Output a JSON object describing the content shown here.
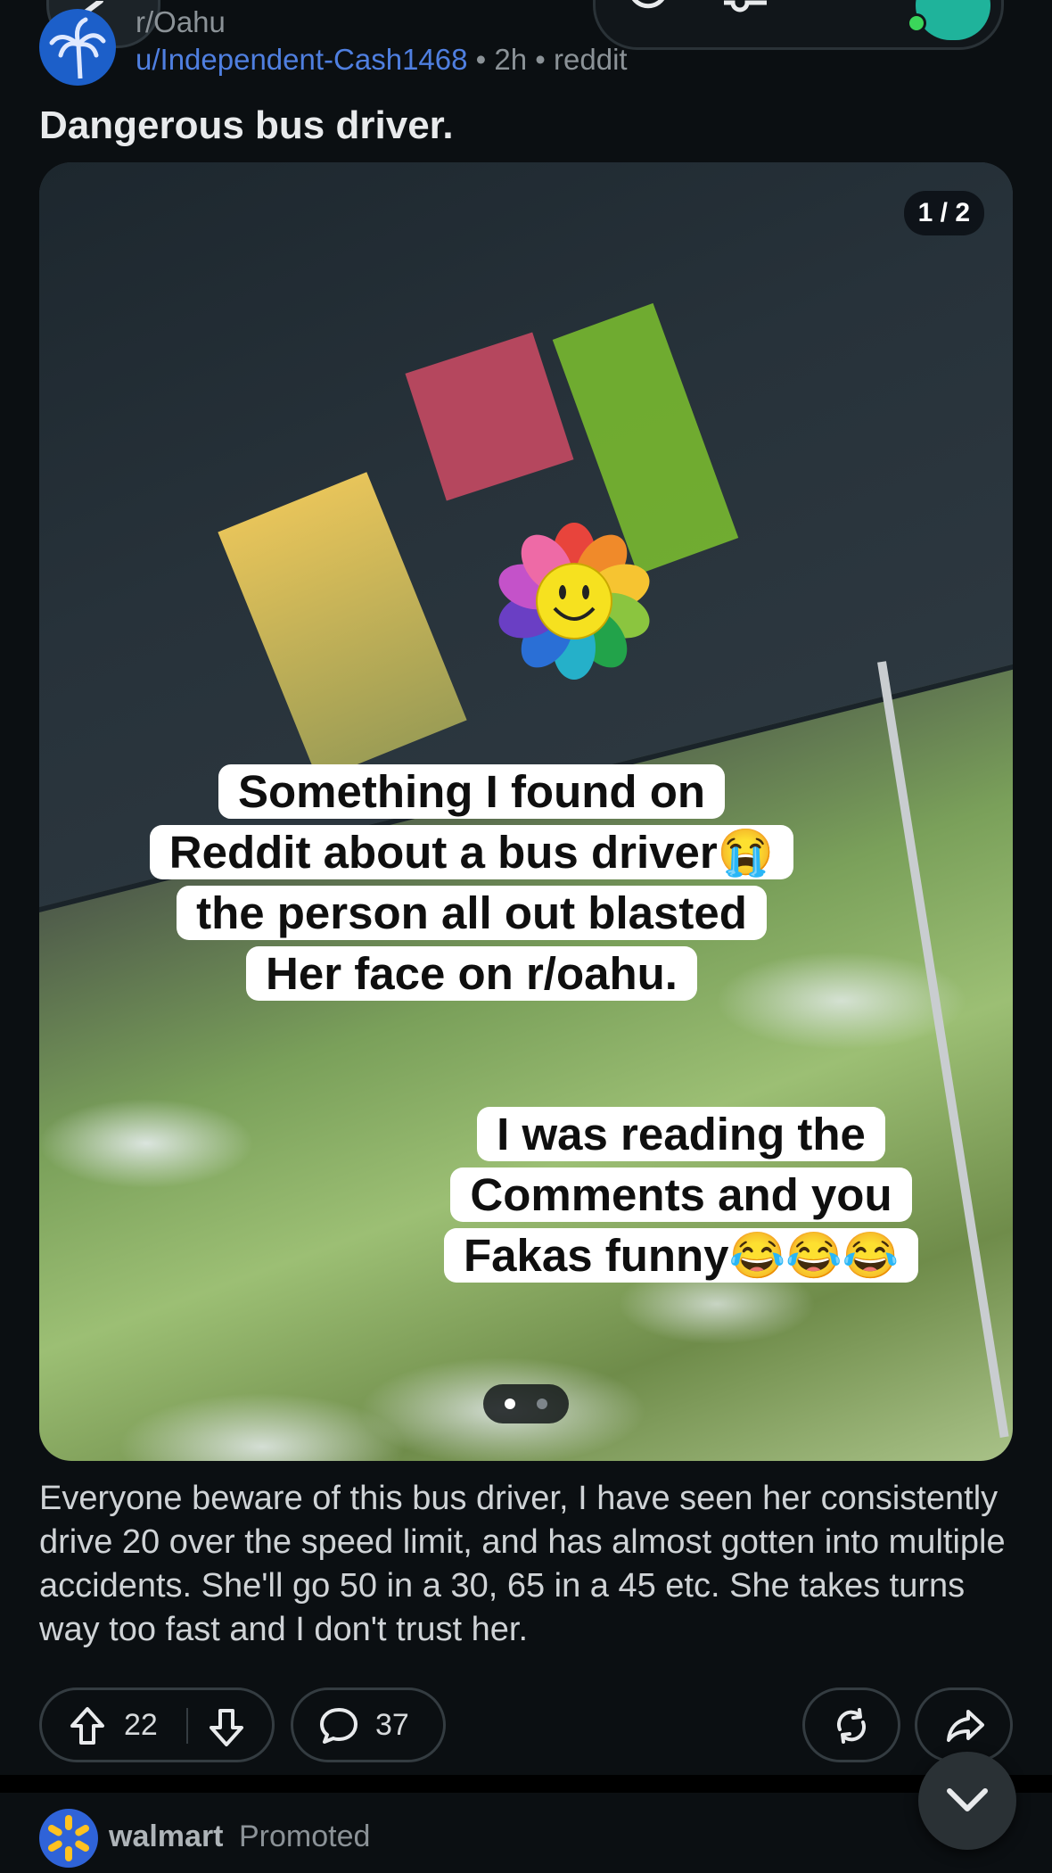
{
  "header": {
    "subreddit": "r/Oahu",
    "username": "u/Independent-Cash1468",
    "time": "2h",
    "source": "reddit",
    "separator": "•"
  },
  "post": {
    "title": "Dangerous bus driver.",
    "image_counter": "1 / 2",
    "overlay_caption_1": [
      "Something I found on",
      "Reddit about a bus driver😭",
      "the person all out blasted",
      "Her face on r/oahu."
    ],
    "overlay_caption_2": [
      "I was reading the",
      "Comments and you",
      "Fakas funny😂😂😂"
    ],
    "body": "Everyone beware of this bus driver, I have seen her consistently drive 20 over the speed limit, and has almost gotten into multiple accidents. She'll go 50 in a 30, 65 in a 45 etc. She takes turns way too fast and I don't trust her.",
    "carousel": {
      "total": 2,
      "active": 1
    }
  },
  "actions": {
    "upvotes": "22",
    "comments": "37"
  },
  "promoted": {
    "advertiser": "walmart",
    "label": "Promoted"
  },
  "colors": {
    "background": "#0b0f12",
    "username_link": "#4f7fe0",
    "muted_text": "#8b9297",
    "pill_border": "#343c41"
  },
  "icons": [
    "back-icon",
    "search-icon",
    "key-icon",
    "upvote-icon",
    "downvote-icon",
    "comment-icon",
    "crosspost-icon",
    "share-icon",
    "chevron-down-icon",
    "walmart-spark-icon"
  ]
}
